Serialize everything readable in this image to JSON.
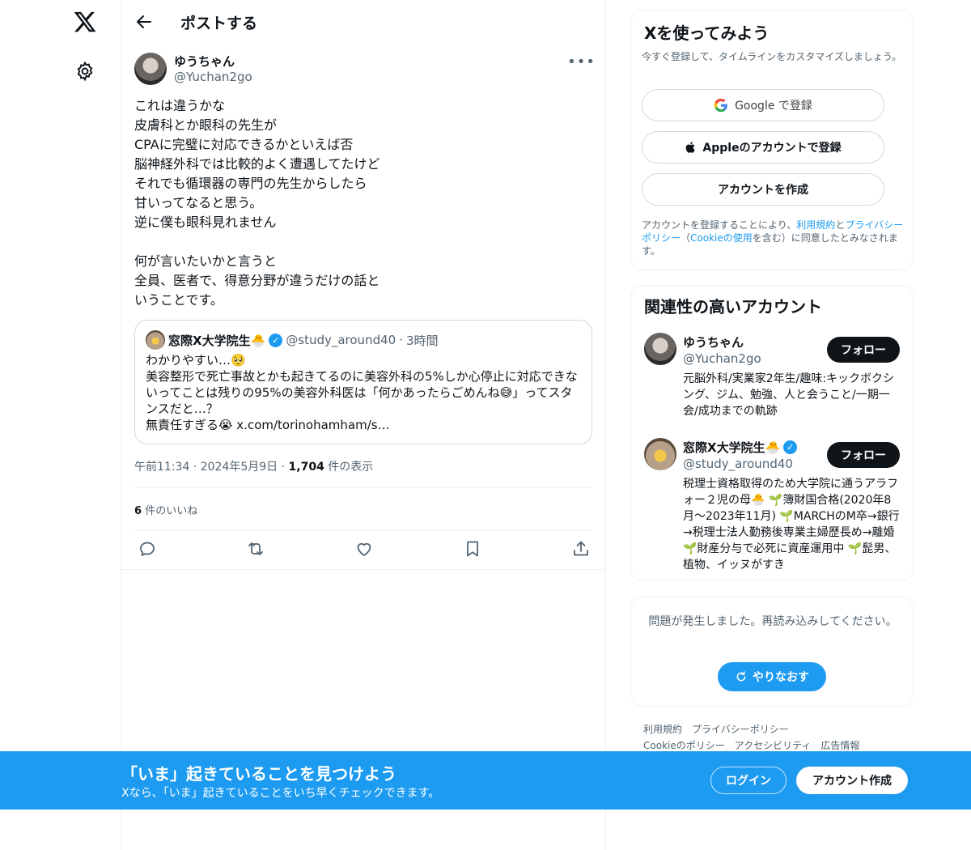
{
  "header": {
    "title": "ポストする"
  },
  "post": {
    "author_name": "ゆうちゃん",
    "author_handle": "@Yuchan2go",
    "text": "これは違うかな\n皮膚科とか眼科の先生が\nCPAに完璧に対応できるかといえば否\n脳神経外科では比較的よく遭遇してたけど\nそれでも循環器の専門の先生からしたら\n甘いってなると思う。\n逆に僕も眼科見れません\n\n何が言いたいかと言うと\n全員、医者で、得意分野が違うだけの話と\nいうことです。",
    "quote": {
      "name": "窓際X大学院生🐣",
      "handle": "@study_around40",
      "time": "3時間",
      "text": "わかりやすい…🥺\n美容整形で死亡事故とかも起きてるのに美容外科の5%しか心停止に対応できないってことは残りの95%の美容外科医は「何かあったらごめんね😅」ってスタンスだと…？\n無責任すぎる😭 x.com/torinohamham/s…"
    },
    "time": "午前11:34",
    "date": "2024年5月9日",
    "views_count": "1,704",
    "views_label": "件の表示",
    "likes_count": "6",
    "likes_label": "件のいいね"
  },
  "signup": {
    "title": "Xを使ってみよう",
    "subtitle": "今すぐ登録して、タイムラインをカスタマイズしましょう。",
    "google_label": "Google で登録",
    "apple_label": "Appleのアカウントで登録",
    "create_label": "アカウントを作成",
    "terms_prefix": "アカウントを登録することにより、",
    "terms_link": "利用規約",
    "terms_and": "と",
    "privacy_link": "プライバシーポリシー",
    "terms_paren_open": "（",
    "cookie_link": "Cookieの使用",
    "terms_suffix": "を含む）に同意したとみなされます。"
  },
  "related": {
    "title": "関連性の高いアカウント",
    "follow_label": "フォロー",
    "accounts": [
      {
        "name": "ゆうちゃん",
        "handle": "@Yuchan2go",
        "bio": "元脳外科/実業家2年生/趣味:キックボクシング、ジム、勉強、人と会うこと/一期一会/成功までの軌跡"
      },
      {
        "name": "窓際X大学院生🐣",
        "handle": "@study_around40",
        "bio": "税理士資格取得のため大学院に通うアラフォー２児の母🐣 🌱簿財国合格(2020年8月～2023年11月) 🌱MARCHのM卒→銀行→税理士法人勤務後専業主婦歴長め→離婚 🌱財産分与で必死に資産運用中 🌱髭男、植物、イッヌがすき"
      }
    ]
  },
  "error": {
    "message": "問題が発生しました。再読み込みしてください。",
    "retry_label": "やりなおす"
  },
  "footer": {
    "links": [
      "利用規約",
      "プライバシーポリシー",
      "Cookieのポリシー",
      "アクセシビリティ",
      "広告情報"
    ]
  },
  "banner": {
    "title": "「いま」起きていることを見つけよう",
    "subtitle": "Xなら、「いま」起きていることをいち早くチェックできます。",
    "login_label": "ログイン",
    "create_label": "アカウント作成"
  },
  "colors": {
    "accent": "#1d9bf0",
    "text": "#0f1419",
    "muted": "#536471",
    "border": "#eff3f4"
  },
  "icons": [
    "x-logo-icon",
    "gear-icon",
    "back-arrow-icon",
    "more-icon",
    "verified-icon",
    "reply-icon",
    "repost-icon",
    "like-icon",
    "bookmark-icon",
    "share-icon",
    "google-icon",
    "apple-icon",
    "refresh-icon"
  ]
}
